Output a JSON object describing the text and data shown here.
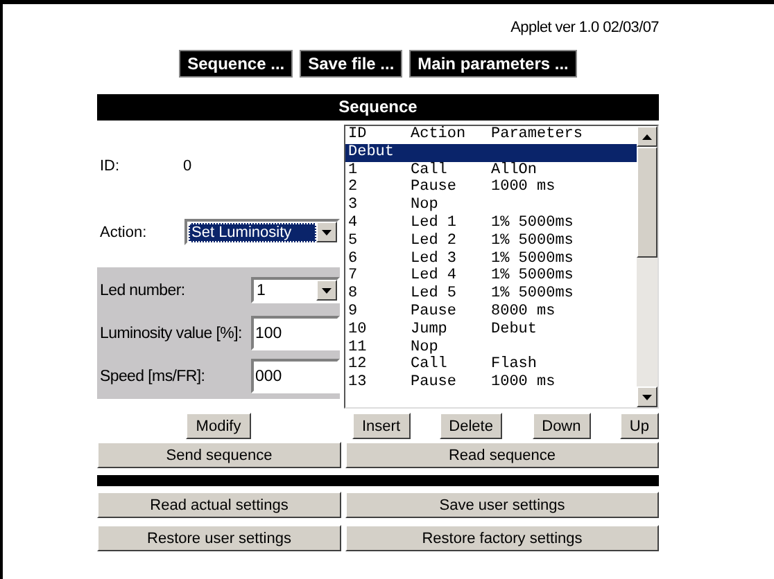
{
  "version": "Applet ver 1.0 02/03/07",
  "menu_buttons": [
    "Sequence ...",
    "Save file ...",
    "Main parameters ..."
  ],
  "section_title": "Sequence",
  "id_field": {
    "label": "ID:",
    "value": "0"
  },
  "action_field": {
    "label": "Action:",
    "value": "Set Luminosity",
    "focused": true
  },
  "parameters": [
    {
      "kind": "select",
      "label": "Led number:",
      "value": "1"
    },
    {
      "kind": "input",
      "label": "Luminosity value [%]:",
      "value": "100"
    },
    {
      "kind": "input",
      "label": "Speed [ms/FR]:",
      "value": "000"
    }
  ],
  "sequence_list": {
    "columns": [
      "ID",
      "Action",
      "Parameters"
    ],
    "rows": [
      {
        "kind": "label",
        "text": "Debut",
        "selected": true
      },
      {
        "kind": "step",
        "id": "1",
        "action": "Call",
        "parameters": "AllOn",
        "selected": false
      },
      {
        "kind": "step",
        "id": "2",
        "action": "Pause",
        "parameters": "1000 ms",
        "selected": false
      },
      {
        "kind": "step",
        "id": "3",
        "action": "Nop",
        "parameters": "",
        "selected": false
      },
      {
        "kind": "step",
        "id": "4",
        "action": "Led 1",
        "parameters": "1% 5000ms",
        "selected": false
      },
      {
        "kind": "step",
        "id": "5",
        "action": "Led 2",
        "parameters": "1% 5000ms",
        "selected": false
      },
      {
        "kind": "step",
        "id": "6",
        "action": "Led 3",
        "parameters": "1% 5000ms",
        "selected": false
      },
      {
        "kind": "step",
        "id": "7",
        "action": "Led 4",
        "parameters": "1% 5000ms",
        "selected": false
      },
      {
        "kind": "step",
        "id": "8",
        "action": "Led 5",
        "parameters": "1% 5000ms",
        "selected": false
      },
      {
        "kind": "step",
        "id": "9",
        "action": "Pause",
        "parameters": "8000 ms",
        "selected": false
      },
      {
        "kind": "step",
        "id": "10",
        "action": "Jump",
        "parameters": "Debut",
        "selected": false
      },
      {
        "kind": "step",
        "id": "11",
        "action": "Nop",
        "parameters": "",
        "selected": false
      },
      {
        "kind": "step",
        "id": "12",
        "action": "Call",
        "parameters": "Flash",
        "selected": false
      },
      {
        "kind": "step",
        "id": "13",
        "action": "Pause",
        "parameters": "1000 ms",
        "selected": false
      }
    ]
  },
  "modify_button": "Modify",
  "list_buttons": [
    "Insert",
    "Delete",
    "Down",
    "Up"
  ],
  "sequence_buttons": [
    "Send sequence",
    "Read sequence"
  ],
  "settings_buttons": [
    "Read actual settings",
    "Save user settings",
    "Restore user settings",
    "Restore factory settings"
  ]
}
